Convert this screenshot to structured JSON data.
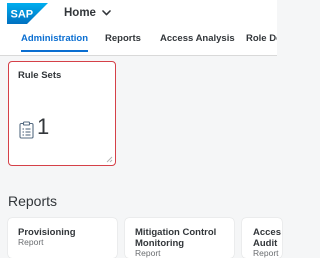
{
  "shell": {
    "logo_text": "SAP",
    "home_label": "Home",
    "home_icon": "chevron-down-icon"
  },
  "tabs": [
    {
      "label": "Administration",
      "active": true
    },
    {
      "label": "Reports",
      "active": false
    },
    {
      "label": "Access Analysis",
      "active": false
    },
    {
      "label": "Role De",
      "active": false
    }
  ],
  "rule_sets_tile": {
    "title": "Rule Sets",
    "count": "1",
    "icon": "clipboard-checklist-icon"
  },
  "reports_section": {
    "title": "Reports",
    "tiles": [
      {
        "title_line1": "Provisioning",
        "title_line2": "",
        "subtitle": "Report"
      },
      {
        "title_line1": "Mitigation Control",
        "title_line2": "Monitoring",
        "subtitle": "Report"
      },
      {
        "title_line1": "Acces",
        "title_line2": "Audit",
        "subtitle": "Report"
      }
    ]
  },
  "colors": {
    "brand_blue": "#0a6ed1",
    "selection_red": "#d54048",
    "text": "#32363a",
    "background": "#f5f6f7"
  }
}
